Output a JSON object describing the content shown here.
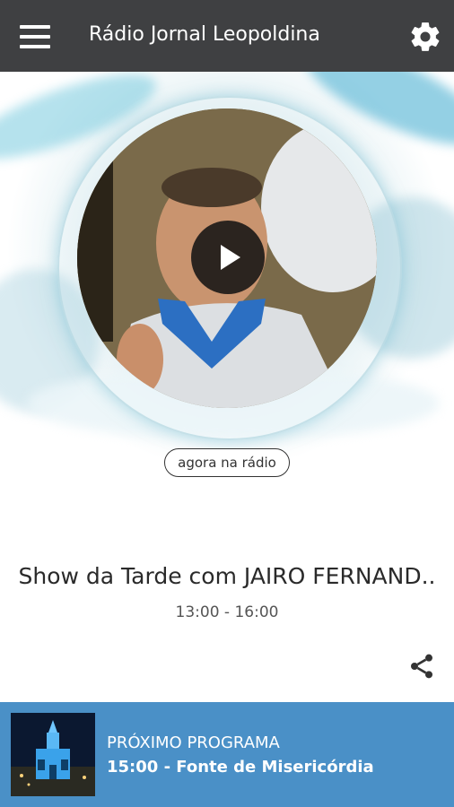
{
  "app": {
    "title": "Rádio Jornal Leopoldina",
    "icons": {
      "menu": "hamburger-menu-icon",
      "settings": "gear-icon"
    }
  },
  "player": {
    "state_icon": "play-icon",
    "now_label": "agora na rádio"
  },
  "current_show": {
    "title": "Show da Tarde com JAIRO FERNAND..",
    "time": "13:00 - 16:00",
    "share_icon": "share-icon"
  },
  "next_program": {
    "label": "PRÓXIMO PROGRAMA",
    "program": "15:00 - Fonte de Misericórdia"
  },
  "colors": {
    "appbar": "#3f4042",
    "accent_blue": "#4a90c7"
  }
}
